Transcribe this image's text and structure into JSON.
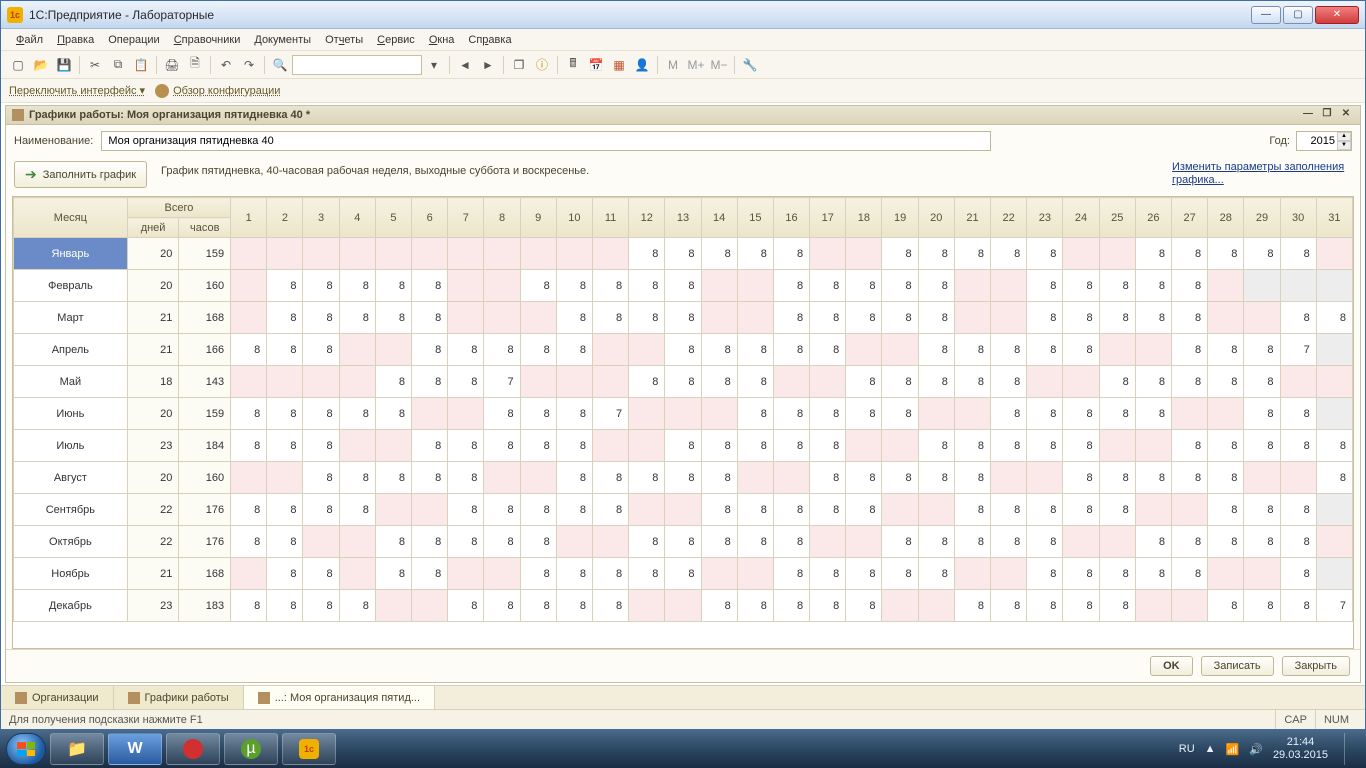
{
  "window": {
    "title": "1С:Предприятие - Лабораторные"
  },
  "menu": {
    "file": "Файл",
    "edit": "Правка",
    "operations": "Операции",
    "directories": "Справочники",
    "documents": "Документы",
    "reports": "Отчеты",
    "service": "Сервис",
    "windows": "Окна",
    "help": "Справка"
  },
  "secondary_toolbar": {
    "switch_iface": "Переключить интерфейс ▾",
    "cfg_overview": "Обзор конфигурации"
  },
  "subwindow": {
    "title": "Графики работы: Моя организация пятидневка 40 *"
  },
  "form": {
    "name_label": "Наименование:",
    "name_value": "Моя организация пятидневка 40",
    "year_label": "Год:",
    "year_value": "2015",
    "fill_btn": "Заполнить график",
    "description": "График пятидневка, 40-часовая рабочая неделя, выходные суббота и воскресенье.",
    "change_link": "Изменить параметры заполнения графика..."
  },
  "table": {
    "hdr_month": "Месяц",
    "hdr_total": "Всего",
    "hdr_days": "дней",
    "hdr_hours": "часов",
    "day_numbers": [
      "1",
      "2",
      "3",
      "4",
      "5",
      "6",
      "7",
      "8",
      "9",
      "10",
      "11",
      "12",
      "13",
      "14",
      "15",
      "16",
      "17",
      "18",
      "19",
      "20",
      "21",
      "22",
      "23",
      "24",
      "25",
      "26",
      "27",
      "28",
      "29",
      "30",
      "31"
    ],
    "rows": [
      {
        "month": "Январь",
        "days": 20,
        "hours": 159,
        "len": 31,
        "cells": [
          "",
          "",
          "",
          "",
          "",
          "",
          "",
          "",
          "",
          "",
          "",
          "8",
          "8",
          "8",
          "8",
          "8",
          "",
          "",
          "8",
          "8",
          "8",
          "8",
          "8",
          "",
          "",
          "8",
          "8",
          "8",
          "8",
          "8",
          ""
        ]
      },
      {
        "month": "Февраль",
        "days": 20,
        "hours": 160,
        "len": 28,
        "cells": [
          "",
          "8",
          "8",
          "8",
          "8",
          "8",
          "",
          "",
          "8",
          "8",
          "8",
          "8",
          "8",
          "",
          "",
          "8",
          "8",
          "8",
          "8",
          "8",
          "",
          "",
          "8",
          "8",
          "8",
          "8",
          "8",
          ""
        ]
      },
      {
        "month": "Март",
        "days": 21,
        "hours": 168,
        "len": 31,
        "cells": [
          "",
          "8",
          "8",
          "8",
          "8",
          "8",
          "",
          "",
          "",
          "8",
          "8",
          "8",
          "8",
          "",
          "",
          "8",
          "8",
          "8",
          "8",
          "8",
          "",
          "",
          "8",
          "8",
          "8",
          "8",
          "8",
          "",
          "",
          "8",
          "8"
        ]
      },
      {
        "month": "Апрель",
        "days": 21,
        "hours": 166,
        "len": 30,
        "cells": [
          "8",
          "8",
          "8",
          "",
          "",
          "8",
          "8",
          "8",
          "8",
          "8",
          "",
          "",
          "8",
          "8",
          "8",
          "8",
          "8",
          "",
          "",
          "8",
          "8",
          "8",
          "8",
          "8",
          "",
          "",
          "8",
          "8",
          "8",
          "7"
        ]
      },
      {
        "month": "Май",
        "days": 18,
        "hours": 143,
        "len": 31,
        "cells": [
          "",
          "",
          "",
          "",
          "8",
          "8",
          "8",
          "7",
          "",
          "",
          "",
          "8",
          "8",
          "8",
          "8",
          "",
          "",
          "8",
          "8",
          "8",
          "8",
          "8",
          "",
          "",
          "8",
          "8",
          "8",
          "8",
          "8",
          "",
          ""
        ]
      },
      {
        "month": "Июнь",
        "days": 20,
        "hours": 159,
        "len": 30,
        "cells": [
          "8",
          "8",
          "8",
          "8",
          "8",
          "",
          "",
          "8",
          "8",
          "8",
          "7",
          "",
          "",
          "",
          "8",
          "8",
          "8",
          "8",
          "8",
          "",
          "",
          "8",
          "8",
          "8",
          "8",
          "8",
          "",
          "",
          "8",
          "8"
        ]
      },
      {
        "month": "Июль",
        "days": 23,
        "hours": 184,
        "len": 31,
        "cells": [
          "8",
          "8",
          "8",
          "",
          "",
          "8",
          "8",
          "8",
          "8",
          "8",
          "",
          "",
          "8",
          "8",
          "8",
          "8",
          "8",
          "",
          "",
          "8",
          "8",
          "8",
          "8",
          "8",
          "",
          "",
          "8",
          "8",
          "8",
          "8",
          "8"
        ]
      },
      {
        "month": "Август",
        "days": 20,
        "hours": 160,
        "len": 31,
        "cells": [
          "",
          "",
          "8",
          "8",
          "8",
          "8",
          "8",
          "",
          "",
          "8",
          "8",
          "8",
          "8",
          "8",
          "",
          "",
          "8",
          "8",
          "8",
          "8",
          "8",
          "",
          "",
          "8",
          "8",
          "8",
          "8",
          "8",
          "",
          "",
          "8"
        ]
      },
      {
        "month": "Сентябрь",
        "days": 22,
        "hours": 176,
        "len": 30,
        "cells": [
          "8",
          "8",
          "8",
          "8",
          "",
          "",
          "8",
          "8",
          "8",
          "8",
          "8",
          "",
          "",
          "8",
          "8",
          "8",
          "8",
          "8",
          "",
          "",
          "8",
          "8",
          "8",
          "8",
          "8",
          "",
          "",
          "8",
          "8",
          "8"
        ]
      },
      {
        "month": "Октябрь",
        "days": 22,
        "hours": 176,
        "len": 31,
        "cells": [
          "8",
          "8",
          "",
          "",
          "8",
          "8",
          "8",
          "8",
          "8",
          "",
          "",
          "8",
          "8",
          "8",
          "8",
          "8",
          "",
          "",
          "8",
          "8",
          "8",
          "8",
          "8",
          "",
          "",
          "8",
          "8",
          "8",
          "8",
          "8",
          ""
        ]
      },
      {
        "month": "Ноябрь",
        "days": 21,
        "hours": 168,
        "len": 30,
        "cells": [
          "",
          "8",
          "8",
          "",
          "8",
          "8",
          "",
          "",
          "8",
          "8",
          "8",
          "8",
          "8",
          "",
          "",
          "8",
          "8",
          "8",
          "8",
          "8",
          "",
          "",
          "8",
          "8",
          "8",
          "8",
          "8",
          "",
          "",
          "8"
        ]
      },
      {
        "month": "Декабрь",
        "days": 23,
        "hours": 183,
        "len": 31,
        "cells": [
          "8",
          "8",
          "8",
          "8",
          "",
          "",
          "8",
          "8",
          "8",
          "8",
          "8",
          "",
          "",
          "8",
          "8",
          "8",
          "8",
          "8",
          "",
          "",
          "8",
          "8",
          "8",
          "8",
          "8",
          "",
          "",
          "8",
          "8",
          "8",
          "7"
        ]
      }
    ]
  },
  "bottom": {
    "ok": "OK",
    "save": "Записать",
    "close": "Закрыть"
  },
  "wintabs": {
    "t1": "Организации",
    "t2": "Графики работы",
    "t3": "...: Моя организация пятид..."
  },
  "statusbar": {
    "hint": "Для получения подсказки нажмите F1",
    "cap": "CAP",
    "num": "NUM"
  },
  "tray": {
    "lang": "RU",
    "time": "21:44",
    "date": "29.03.2015"
  }
}
